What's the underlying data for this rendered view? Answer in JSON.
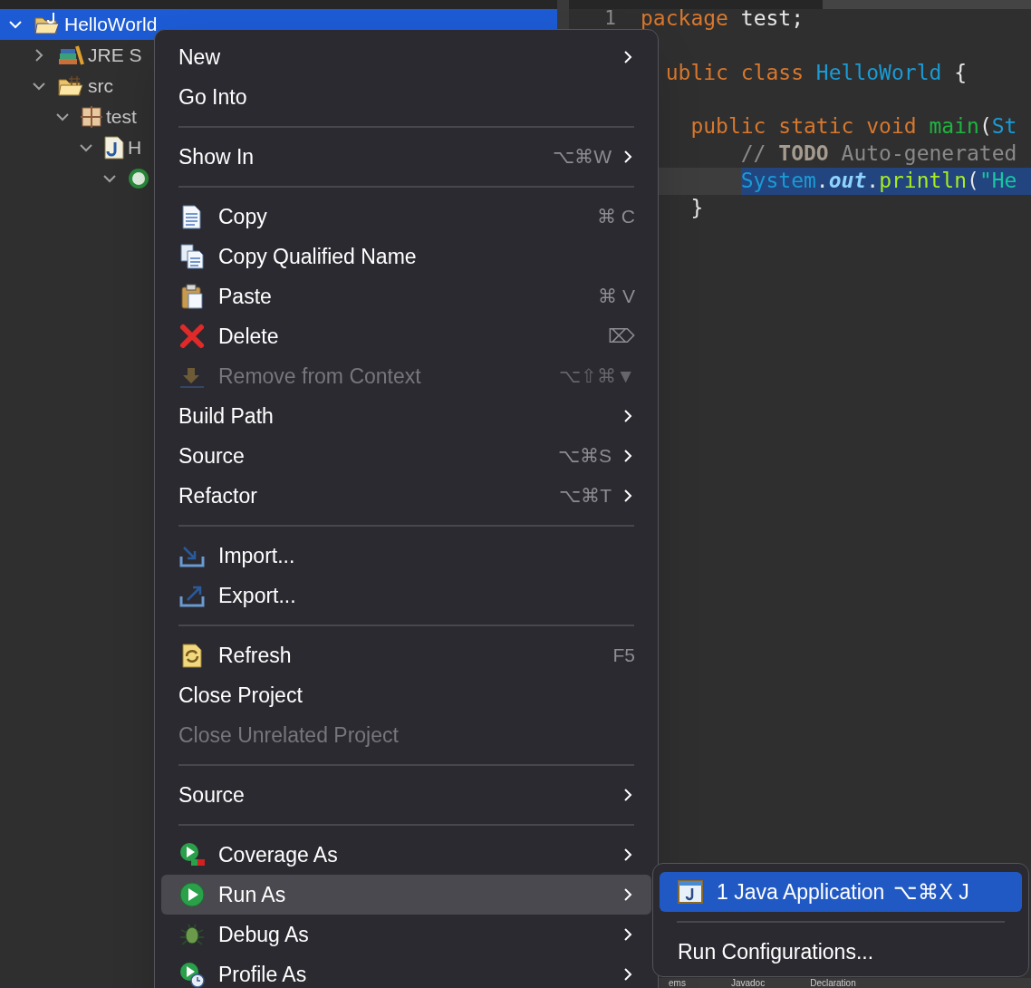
{
  "tree": [
    {
      "label": "HelloWorld",
      "expanded": true,
      "selected": true,
      "children": [
        {
          "label": "JRE S",
          "expanded": false,
          "selected": false
        },
        {
          "label": "src",
          "expanded": true,
          "selected": false,
          "children": [
            {
              "label": "test",
              "expanded": true,
              "selected": false,
              "children": [
                {
                  "label": "H",
                  "expanded": true,
                  "selected": false,
                  "children": [
                    {
                      "expanded": true,
                      "selected": false
                    }
                  ]
                }
              ]
            }
          ]
        }
      ]
    }
  ],
  "editor": {
    "lines": [
      {
        "kind": "top",
        "number": "1",
        "tokens": [
          {
            "text": "package ",
            "kind": "keyword"
          },
          {
            "text": "test;",
            "kind": "plain"
          }
        ]
      },
      {
        "kind": "blank"
      },
      {
        "kind": "clipped",
        "tokens": [
          {
            "text": "ublic class ",
            "kind": "keyword"
          },
          {
            "text": "HelloWorld",
            "kind": "type"
          },
          {
            "text": " {",
            "kind": "plain"
          }
        ]
      },
      {
        "kind": "blank"
      },
      {
        "kind": "member",
        "tokens": [
          {
            "text": "public static void ",
            "kind": "keyword"
          },
          {
            "text": "main",
            "kind": "method"
          },
          {
            "text": "(",
            "kind": "plain"
          },
          {
            "text": "St",
            "kind": "type"
          }
        ]
      },
      {
        "kind": "statement",
        "tokens": [
          {
            "text": "// ",
            "kind": "comment"
          },
          {
            "text": "TODO",
            "kind": "todo"
          },
          {
            "text": " Auto-generated",
            "kind": "comment"
          }
        ]
      },
      {
        "kind": "statement",
        "current": true,
        "selected": true,
        "tokens": [
          {
            "text": "System",
            "kind": "type"
          },
          {
            "text": ".",
            "kind": "plain"
          },
          {
            "text": "out",
            "kind": "field"
          },
          {
            "text": ".",
            "kind": "plain"
          },
          {
            "text": "println",
            "kind": "call"
          },
          {
            "text": "(",
            "kind": "plain"
          },
          {
            "text": "\"He",
            "kind": "string"
          }
        ]
      },
      {
        "kind": "member",
        "tokens": [
          {
            "text": "}",
            "kind": "plain"
          }
        ]
      }
    ]
  },
  "bottom_tabs": [
    "ems",
    "Javadoc",
    "Declaration"
  ],
  "context_menu": {
    "items": [
      {
        "kind": "item",
        "label": "New",
        "submenu": true,
        "disabled": false,
        "selected": false
      },
      {
        "kind": "item",
        "label": "Go Into",
        "submenu": false,
        "disabled": false,
        "selected": false
      },
      {
        "kind": "separator"
      },
      {
        "kind": "item",
        "label": "Show In",
        "shortcut": "⌥⌘W",
        "submenu": true,
        "disabled": false,
        "selected": false
      },
      {
        "kind": "separator"
      },
      {
        "kind": "item",
        "label": "Copy",
        "shortcut": "⌘ C",
        "submenu": false,
        "disabled": false,
        "selected": false
      },
      {
        "kind": "item",
        "label": "Copy Qualified Name",
        "submenu": false,
        "disabled": false,
        "selected": false
      },
      {
        "kind": "item",
        "label": "Paste",
        "shortcut": "⌘ V",
        "submenu": false,
        "disabled": false,
        "selected": false
      },
      {
        "kind": "item",
        "label": "Delete",
        "shortcut": "⌦",
        "submenu": false,
        "disabled": false,
        "selected": false
      },
      {
        "kind": "item",
        "label": "Remove from Context",
        "shortcut": "⌥⇧⌘▼",
        "submenu": false,
        "disabled": true,
        "selected": false
      },
      {
        "kind": "item",
        "label": "Build Path",
        "submenu": true,
        "disabled": false,
        "selected": false
      },
      {
        "kind": "item",
        "label": "Source",
        "shortcut": "⌥⌘S",
        "submenu": true,
        "disabled": false,
        "selected": false
      },
      {
        "kind": "item",
        "label": "Refactor",
        "shortcut": "⌥⌘T",
        "submenu": true,
        "disabled": false,
        "selected": false
      },
      {
        "kind": "separator"
      },
      {
        "kind": "item",
        "label": "Import...",
        "submenu": false,
        "disabled": false,
        "selected": false
      },
      {
        "kind": "item",
        "label": "Export...",
        "submenu": false,
        "disabled": false,
        "selected": false
      },
      {
        "kind": "separator"
      },
      {
        "kind": "item",
        "label": "Refresh",
        "shortcut": "F5",
        "submenu": false,
        "disabled": false,
        "selected": false
      },
      {
        "kind": "item",
        "label": "Close Project",
        "submenu": false,
        "disabled": false,
        "selected": false
      },
      {
        "kind": "item",
        "label": "Close Unrelated Project",
        "submenu": false,
        "disabled": true,
        "selected": false
      },
      {
        "kind": "separator"
      },
      {
        "kind": "item",
        "label": "Source",
        "submenu": true,
        "disabled": false,
        "selected": false
      },
      {
        "kind": "separator"
      },
      {
        "kind": "item",
        "label": "Coverage As",
        "submenu": true,
        "disabled": false,
        "selected": false
      },
      {
        "kind": "item",
        "label": "Run As",
        "submenu": true,
        "disabled": false,
        "selected": true
      },
      {
        "kind": "item",
        "label": "Debug As",
        "submenu": true,
        "disabled": false,
        "selected": false
      },
      {
        "kind": "item",
        "label": "Profile As",
        "submenu": true,
        "disabled": false,
        "selected": false
      }
    ]
  },
  "submenu": {
    "items": [
      {
        "kind": "item",
        "label": "1 Java Application",
        "shortcut": "⌥⌘X J",
        "selected": true
      },
      {
        "kind": "separator"
      },
      {
        "kind": "item",
        "label": "Run Configurations...",
        "selected": false
      }
    ]
  }
}
